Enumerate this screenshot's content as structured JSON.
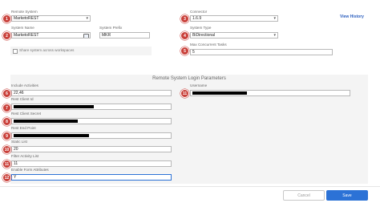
{
  "header": {
    "view_history": "View History"
  },
  "fields": {
    "remote_system": {
      "label": "Remote System",
      "value": "MarketoREST",
      "badge": "1"
    },
    "system_name": {
      "label": "System Name",
      "value": "MarketoREST",
      "badge": "2"
    },
    "system_prefix": {
      "label": "System Prefix",
      "value": "MKR"
    },
    "share_checkbox": {
      "label": "Share system across workspaces"
    },
    "connector": {
      "label": "Connector",
      "value": "1.6.9",
      "badge": "3"
    },
    "system_type": {
      "label": "System Type",
      "value": "BiDirectional",
      "badge": "4"
    },
    "max_tasks": {
      "label": "Max Concurrent Tasks",
      "value": "5",
      "badge": "5"
    }
  },
  "login_section": {
    "title": "Remote System Login Parameters",
    "include_activities": {
      "label": "Include Activities",
      "value": "22,46",
      "badge": "6"
    },
    "username": {
      "label": "Username",
      "value": "",
      "badge": "11"
    },
    "rest_client_id": {
      "label": "Rest Client Id",
      "value": "",
      "badge": "7"
    },
    "rest_client_secret": {
      "label": "Rest Client Secret",
      "value": "",
      "badge": "8"
    },
    "rest_end_point": {
      "label": "Rest End Point",
      "value": "",
      "badge": "9"
    },
    "static_list": {
      "label": "Static List",
      "value": "20",
      "badge": "10"
    },
    "filter_activity_list": {
      "label": "Filter Activity List",
      "value": "11",
      "badge": "11"
    },
    "enable_form_attributes": {
      "label": "Enable Form Attributes",
      "value": "Y",
      "badge": "12"
    }
  },
  "footer": {
    "cancel": "Cancel",
    "save": "Save"
  },
  "colors": {
    "badge": "#c9403a",
    "accent": "#2c72d6",
    "link": "#2c5fbf"
  }
}
